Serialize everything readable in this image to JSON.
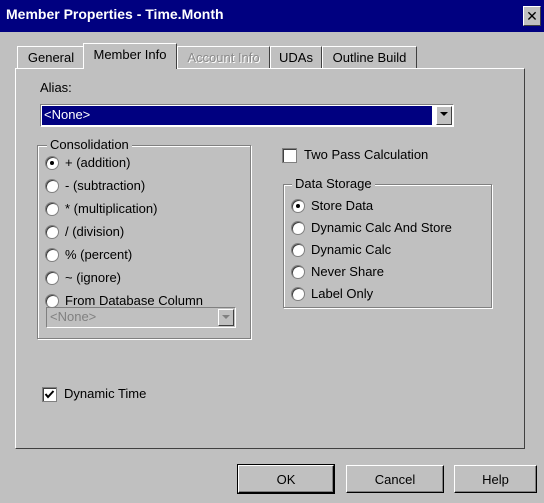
{
  "window": {
    "title": "Member Properties - Time.Month",
    "close_glyph": "✕"
  },
  "tabs": [
    {
      "label": "General",
      "active": false,
      "enabled": true
    },
    {
      "label": "Member Info",
      "active": true,
      "enabled": true
    },
    {
      "label": "Account Info",
      "active": false,
      "enabled": false
    },
    {
      "label": "UDAs",
      "active": false,
      "enabled": true
    },
    {
      "label": "Outline Build",
      "active": false,
      "enabled": true
    }
  ],
  "alias": {
    "label": "Alias:",
    "value": "<None>"
  },
  "consolidation": {
    "legend": "Consolidation",
    "options": [
      {
        "label": "+ (addition)",
        "selected": true
      },
      {
        "label": "- (subtraction)",
        "selected": false
      },
      {
        "label": "* (multiplication)",
        "selected": false
      },
      {
        "label": "/ (division)",
        "selected": false
      },
      {
        "label": "% (percent)",
        "selected": false
      },
      {
        "label": "~ (ignore)",
        "selected": false
      },
      {
        "label": "From Database Column",
        "selected": false
      }
    ],
    "column_select": {
      "value": "<None>",
      "enabled": false
    }
  },
  "two_pass": {
    "label": "Two Pass Calculation",
    "checked": false
  },
  "data_storage": {
    "legend": "Data Storage",
    "options": [
      {
        "label": "Store Data",
        "selected": true
      },
      {
        "label": "Dynamic Calc And Store",
        "selected": false
      },
      {
        "label": "Dynamic Calc",
        "selected": false
      },
      {
        "label": "Never Share",
        "selected": false
      },
      {
        "label": "Label Only",
        "selected": false
      }
    ]
  },
  "dynamic_time": {
    "label": "Dynamic Time",
    "checked": true
  },
  "buttons": {
    "ok": "OK",
    "cancel": "Cancel",
    "help": "Help"
  }
}
